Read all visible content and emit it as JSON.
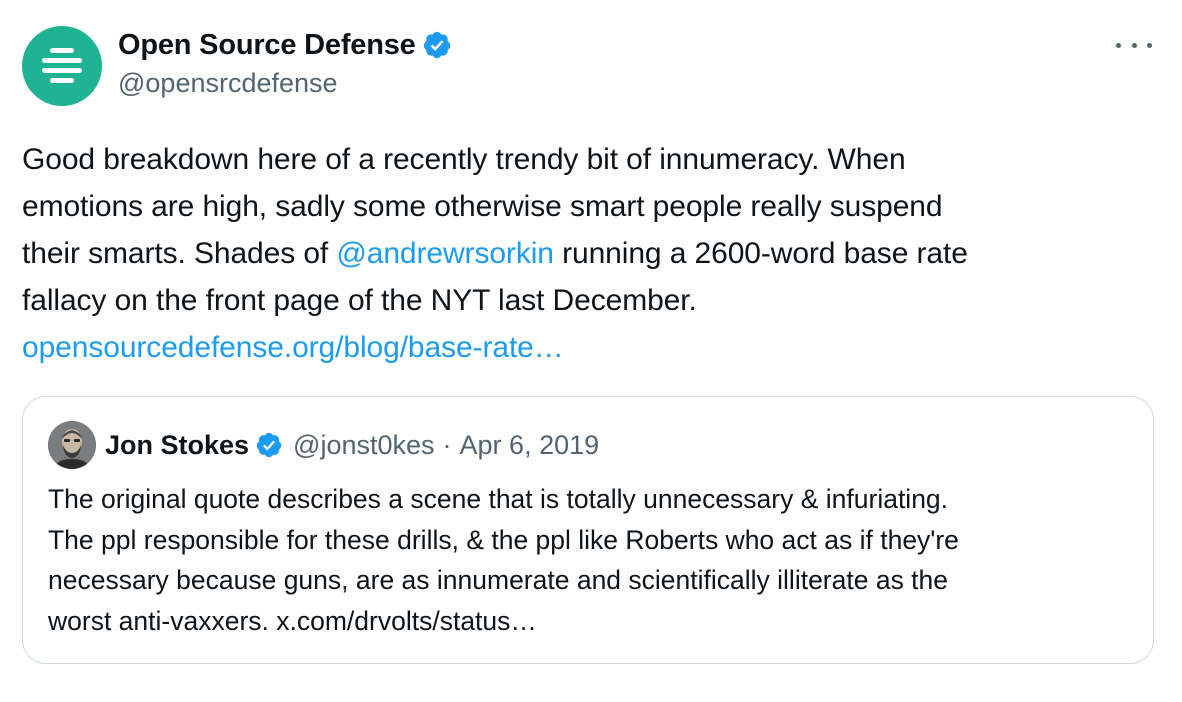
{
  "author": {
    "display_name": "Open Source Defense",
    "handle": "@opensrcdefense",
    "avatar_color": "#1db393",
    "avatar_icon": "stacked-bars-logo-icon",
    "verified": true
  },
  "more_icon": "more-horizontal-icon",
  "body": {
    "line1": "Good breakdown here of a recently trendy bit of innumeracy. When",
    "line2": "emotions are high, sadly some otherwise smart people really suspend",
    "line3_before": "their smarts. Shades of ",
    "line3_mention": "@andrewrsorkin",
    "line3_after": " running a 2600-word base rate",
    "line4": "fallacy on the front page of the NYT last December.",
    "link": "opensourcedefense.org/blog/base-rate…"
  },
  "quote": {
    "display_name": "Jon Stokes",
    "handle": "@jonst0kes",
    "separator": "·",
    "date": "Apr 6, 2019",
    "verified": true,
    "lines": [
      "The original quote describes a scene that is totally unnecessary & infuriating.",
      "The ppl responsible for these drills, & the ppl like Roberts who act as if they're",
      "necessary because guns, are as innumerate and scientifically illiterate as the",
      "worst anti-vaxxers. x.com/drvolts/status…"
    ]
  },
  "colors": {
    "link": "#1d9bf0",
    "verified": "#1d9bf0",
    "secondary_text": "#536471",
    "border": "#cfd9de"
  }
}
